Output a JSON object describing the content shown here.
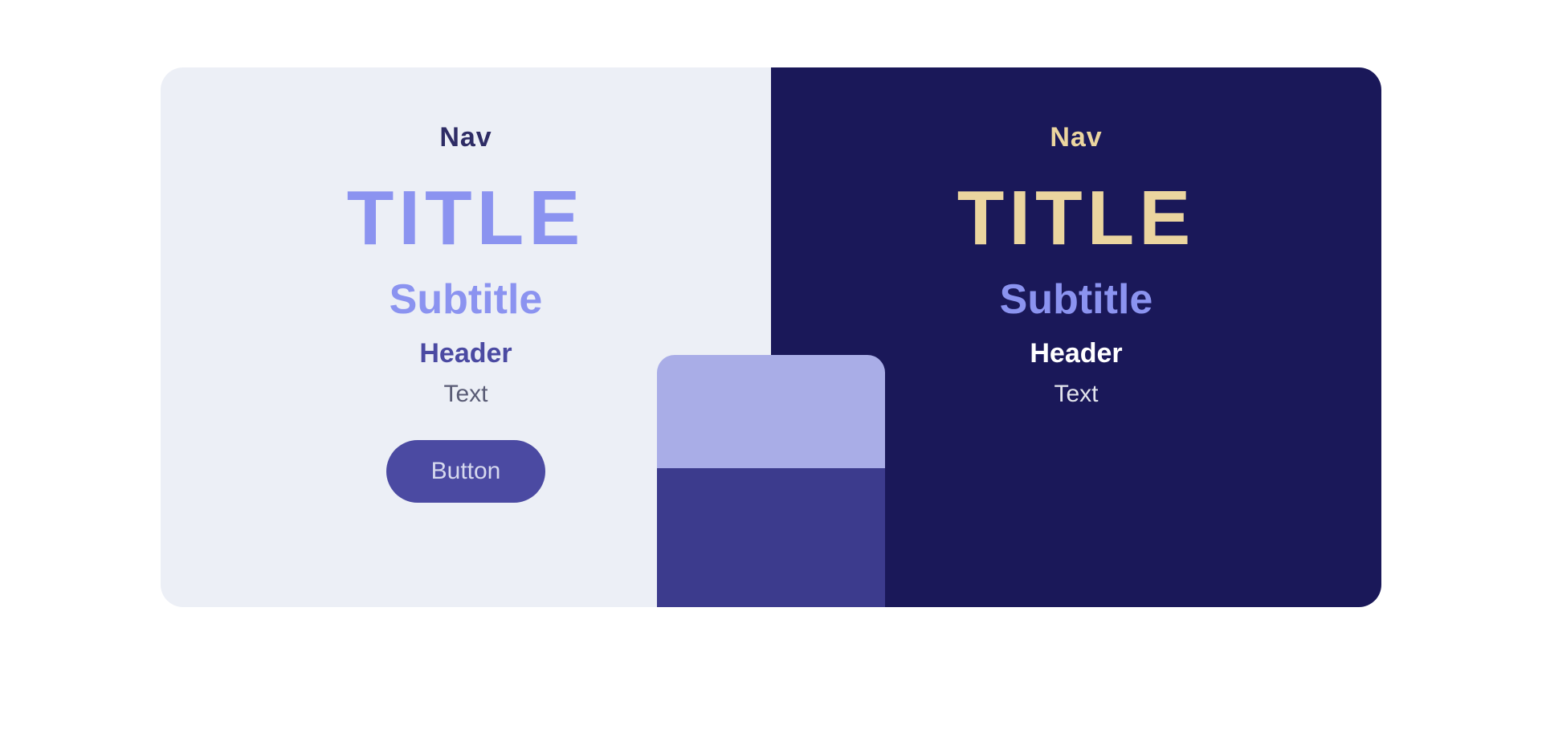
{
  "light": {
    "nav": "Nav",
    "title": "TITLE",
    "subtitle": "Subtitle",
    "header": "Header",
    "text": "Text",
    "button": "Button"
  },
  "dark": {
    "nav": "Nav",
    "title": "TITLE",
    "subtitle": "Subtitle",
    "header": "Header",
    "text": "Text"
  },
  "colors": {
    "light_bg": "#ECEFF6",
    "dark_bg": "#1A1859",
    "accent_primary": "#8B93F0",
    "accent_secondary": "#4B4AA2",
    "accent_gold": "#EBD59F",
    "card_top": "#A9ADE7",
    "card_bottom": "#3C3B8D"
  }
}
